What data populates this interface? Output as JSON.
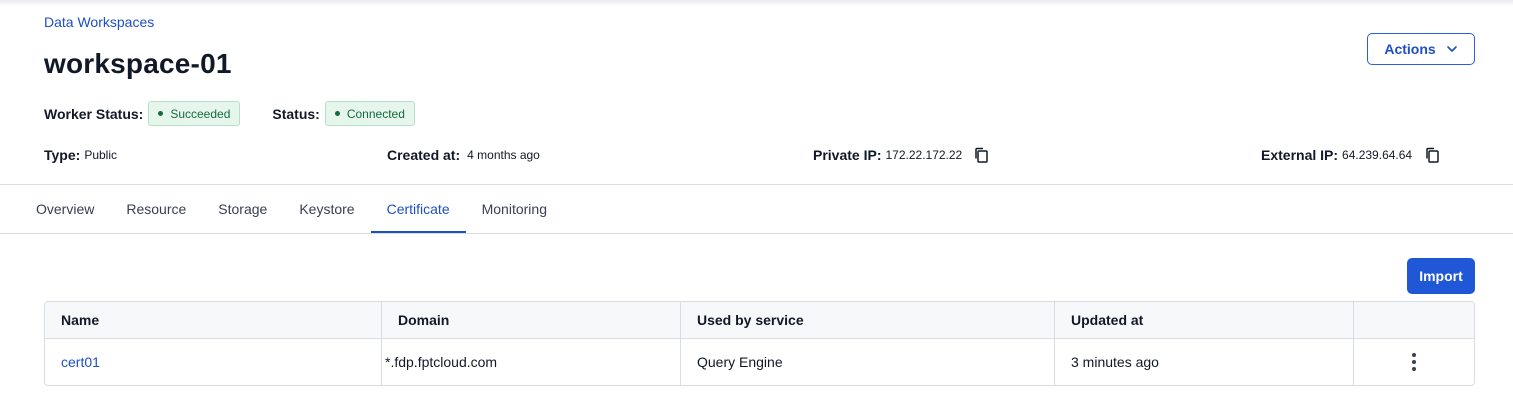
{
  "breadcrumb": "Data Workspaces",
  "title": "workspace-01",
  "actions_label": "Actions",
  "worker_status": {
    "label": "Worker Status:",
    "value": "Succeeded"
  },
  "status": {
    "label": "Status:",
    "value": "Connected"
  },
  "info": {
    "type": {
      "label": "Type:",
      "value": "Public"
    },
    "created": {
      "label": "Created at:",
      "value": "4 months ago"
    },
    "private_ip": {
      "label": "Private IP:",
      "value": "172.22.172.22"
    },
    "external_ip": {
      "label": "External IP:",
      "value": "64.239.64.64"
    }
  },
  "tabs": [
    {
      "label": "Overview"
    },
    {
      "label": "Resource"
    },
    {
      "label": "Storage"
    },
    {
      "label": "Keystore"
    },
    {
      "label": "Certificate",
      "active": true
    },
    {
      "label": "Monitoring"
    }
  ],
  "import_label": "Import",
  "table": {
    "columns": [
      "Name",
      "Domain",
      "Used by service",
      "Updated at"
    ],
    "rows": [
      {
        "name": "cert01",
        "domain": "*.fdp.fptcloud.com",
        "service": "Query Engine",
        "updated": "3 minutes ago"
      }
    ]
  },
  "colors": {
    "accent": "#1e4fc4",
    "success_bg": "#e6f6ec",
    "success_text": "#176b3c"
  },
  "icons": {
    "actions": "chevron-down-icon",
    "copy": "copy-icon",
    "row_menu": "more-vertical-icon"
  }
}
